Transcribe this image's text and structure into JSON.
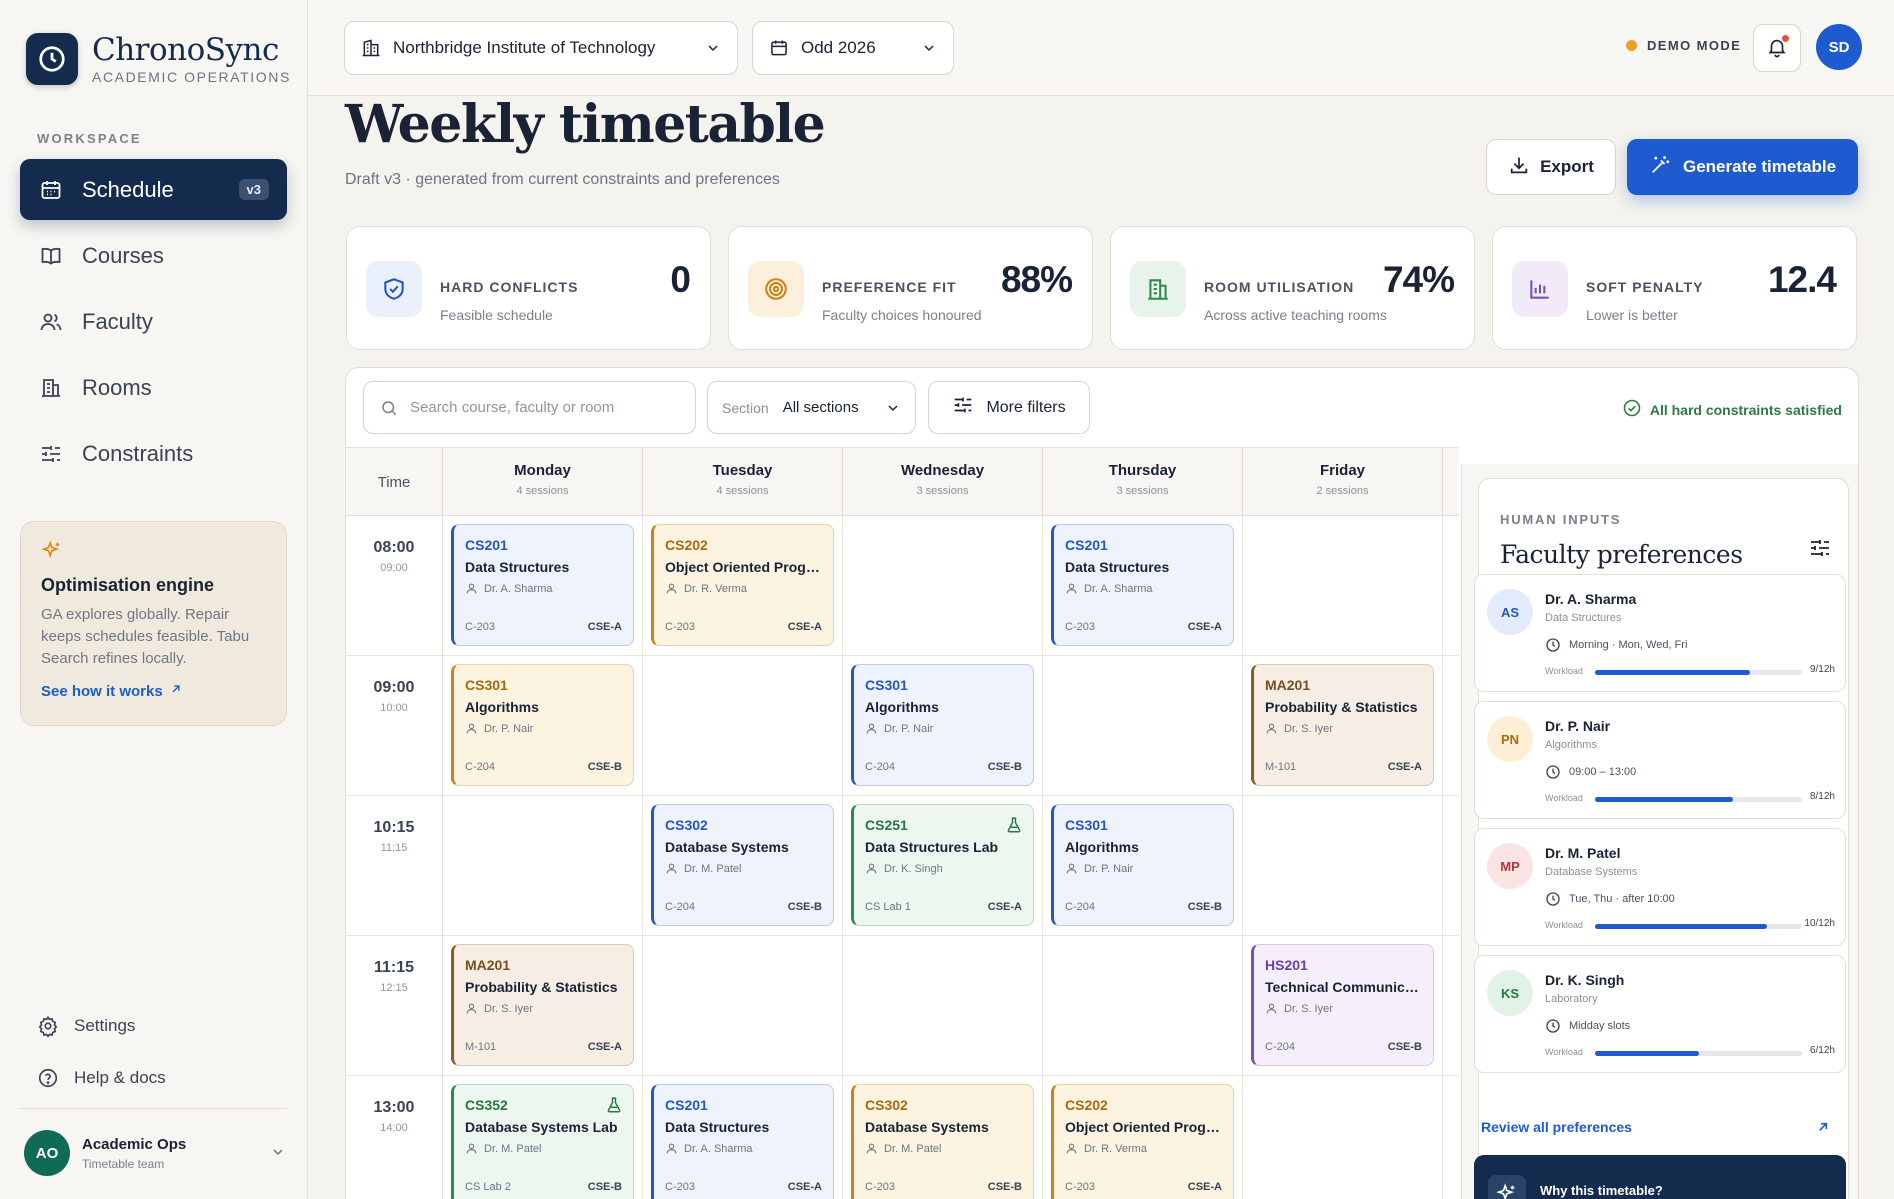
{
  "brand": {
    "name": "ChronoSync",
    "subtitle": "ACADEMIC OPERATIONS"
  },
  "sidebar": {
    "section_label": "WORKSPACE",
    "items": [
      {
        "label": "Schedule",
        "icon": "calendar-icon",
        "badge": "v3",
        "active": true
      },
      {
        "label": "Courses",
        "icon": "book-icon"
      },
      {
        "label": "Faculty",
        "icon": "users-icon"
      },
      {
        "label": "Rooms",
        "icon": "building-icon"
      },
      {
        "label": "Constraints",
        "icon": "sliders-icon"
      }
    ],
    "engine": {
      "title": "Optimisation engine",
      "description": "GA explores globally. Repair keeps schedules feasible. Tabu Search refines locally.",
      "link": "See how it works"
    },
    "settings": "Settings",
    "help": "Help & docs",
    "user": {
      "initials": "AO",
      "name": "Academic Ops",
      "role": "Timetable team"
    }
  },
  "topbar": {
    "institution": "Northbridge Institute of Technology",
    "term": "Odd 2026",
    "demo": "DEMO MODE",
    "avatar": "SD"
  },
  "header": {
    "title": "Weekly timetable",
    "subtitle": "Draft v3 · generated from current constraints and preferences",
    "export": "Export",
    "generate": "Generate timetable"
  },
  "stats": [
    {
      "label": "HARD CONFLICTS",
      "desc": "Feasible schedule",
      "value": "0",
      "color": "#2457c5",
      "bg": "#eaf0fc"
    },
    {
      "label": "PREFERENCE FIT",
      "desc": "Faculty choices honoured",
      "value": "88%",
      "color": "#c98414",
      "bg": "#fcf0dc"
    },
    {
      "label": "ROOM UTILISATION",
      "desc": "Across active teaching rooms",
      "value": "74%",
      "color": "#2f8a4c",
      "bg": "#e8f4eb"
    },
    {
      "label": "SOFT PENALTY",
      "desc": "Lower is better",
      "value": "12.4",
      "color": "#7a4fb8",
      "bg": "#f1ebf9"
    }
  ],
  "filters": {
    "search_placeholder": "Search course, faculty or room",
    "section_label": "Section",
    "section_value": "All sections",
    "more": "More filters",
    "status": "All hard constraints satisfied"
  },
  "timetable": {
    "time_label": "Time",
    "days": [
      {
        "name": "Monday",
        "count": "4 sessions"
      },
      {
        "name": "Tuesday",
        "count": "4 sessions"
      },
      {
        "name": "Wednesday",
        "count": "3 sessions"
      },
      {
        "name": "Thursday",
        "count": "3 sessions"
      },
      {
        "name": "Friday",
        "count": "2 sessions"
      }
    ],
    "slots": [
      {
        "start": "08:00",
        "end": "09:00"
      },
      {
        "start": "09:00",
        "end": "10:00"
      },
      {
        "start": "10:15",
        "end": "11:15"
      },
      {
        "start": "11:15",
        "end": "12:15"
      },
      {
        "start": "13:00",
        "end": "14:00"
      }
    ],
    "sessions": [
      {
        "day": 0,
        "slot": 0,
        "code": "CS201",
        "title": "Data Structures",
        "faculty": "Dr. A. Sharma",
        "room": "C-203",
        "section": "CSE-A",
        "color": "blue"
      },
      {
        "day": 1,
        "slot": 0,
        "code": "CS202",
        "title": "Object Oriented Progr...",
        "faculty": "Dr. R. Verma",
        "room": "C-203",
        "section": "CSE-A",
        "color": "orange"
      },
      {
        "day": 3,
        "slot": 0,
        "code": "CS201",
        "title": "Data Structures",
        "faculty": "Dr. A. Sharma",
        "room": "C-203",
        "section": "CSE-A",
        "color": "blue"
      },
      {
        "day": 0,
        "slot": 1,
        "code": "CS301",
        "title": "Algorithms",
        "faculty": "Dr. P. Nair",
        "room": "C-204",
        "section": "CSE-B",
        "color": "orange"
      },
      {
        "day": 2,
        "slot": 1,
        "code": "CS301",
        "title": "Algorithms",
        "faculty": "Dr. P. Nair",
        "room": "C-204",
        "section": "CSE-B",
        "color": "blue"
      },
      {
        "day": 4,
        "slot": 1,
        "code": "MA201",
        "title": "Probability & Statistics",
        "faculty": "Dr. S. Iyer",
        "room": "M-101",
        "section": "CSE-A",
        "color": "brown"
      },
      {
        "day": 1,
        "slot": 2,
        "code": "CS302",
        "title": "Database Systems",
        "faculty": "Dr. M. Patel",
        "room": "C-204",
        "section": "CSE-B",
        "color": "blue"
      },
      {
        "day": 2,
        "slot": 2,
        "code": "CS251",
        "title": "Data Structures Lab",
        "faculty": "Dr. K. Singh",
        "room": "CS Lab 1",
        "section": "CSE-A",
        "color": "green",
        "lab": true
      },
      {
        "day": 3,
        "slot": 2,
        "code": "CS301",
        "title": "Algorithms",
        "faculty": "Dr. P. Nair",
        "room": "C-204",
        "section": "CSE-B",
        "color": "blue"
      },
      {
        "day": 0,
        "slot": 3,
        "code": "MA201",
        "title": "Probability & Statistics",
        "faculty": "Dr. S. Iyer",
        "room": "M-101",
        "section": "CSE-A",
        "color": "brown"
      },
      {
        "day": 4,
        "slot": 3,
        "code": "HS201",
        "title": "Technical Communicat...",
        "faculty": "Dr. S. Iyer",
        "room": "C-204",
        "section": "CSE-B",
        "color": "purple"
      },
      {
        "day": 0,
        "slot": 4,
        "code": "CS352",
        "title": "Database Systems Lab",
        "faculty": "Dr. M. Patel",
        "room": "CS Lab 2",
        "section": "CSE-B",
        "color": "green",
        "lab": true
      },
      {
        "day": 1,
        "slot": 4,
        "code": "CS201",
        "title": "Data Structures",
        "faculty": "Dr. A. Sharma",
        "room": "C-203",
        "section": "CSE-A",
        "color": "blue"
      },
      {
        "day": 2,
        "slot": 4,
        "code": "CS302",
        "title": "Database Systems",
        "faculty": "Dr. M. Patel",
        "room": "C-203",
        "section": "CSE-B",
        "color": "orange"
      },
      {
        "day": 3,
        "slot": 4,
        "code": "CS202",
        "title": "Object Oriented Progr...",
        "faculty": "Dr. R. Verma",
        "room": "C-203",
        "section": "CSE-A",
        "color": "orange"
      }
    ]
  },
  "preferences": {
    "kicker": "HUMAN INPUTS",
    "title": "Faculty preferences",
    "workload_label": "Workload",
    "items": [
      {
        "initials": "AS",
        "name": "Dr. A. Sharma",
        "subject": "Data Structures",
        "pref": "Morning · Mon, Wed, Fri",
        "workload": "9/12h",
        "fraction": 0.75,
        "avatar_bg": "#e3ebfb",
        "avatar_fg": "#2457c5"
      },
      {
        "initials": "PN",
        "name": "Dr. P. Nair",
        "subject": "Algorithms",
        "pref": "09:00 – 13:00",
        "workload": "8/12h",
        "fraction": 0.667,
        "avatar_bg": "#fcefd6",
        "avatar_fg": "#a86a0a"
      },
      {
        "initials": "MP",
        "name": "Dr. M. Patel",
        "subject": "Database Systems",
        "pref": "Tue, Thu · after 10:00",
        "workload": "10/12h",
        "fraction": 0.833,
        "avatar_bg": "#fbe4e4",
        "avatar_fg": "#b33a3a"
      },
      {
        "initials": "KS",
        "name": "Dr. K. Singh",
        "subject": "Laboratory",
        "pref": "Midday slots",
        "workload": "6/12h",
        "fraction": 0.5,
        "avatar_bg": "#e3f2e7",
        "avatar_fg": "#26763f"
      }
    ],
    "review": "Review all preferences",
    "why": "Why this timetable?"
  }
}
